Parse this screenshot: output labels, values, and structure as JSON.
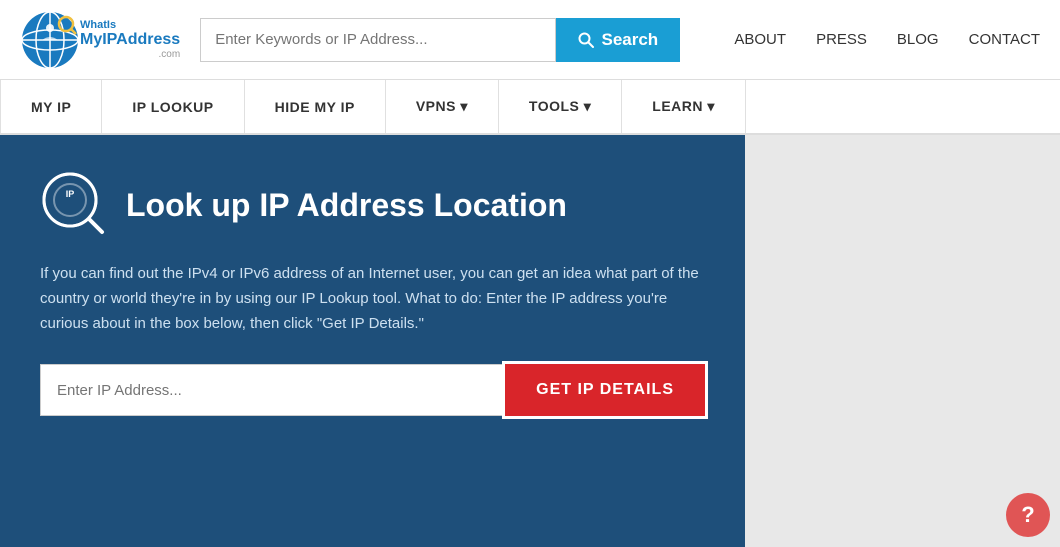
{
  "header": {
    "logo": {
      "what": "WhatIs",
      "myip": "MyIP",
      "address": "Address",
      "com": ".com"
    },
    "search": {
      "placeholder": "Enter Keywords or IP Address...",
      "button_label": "Search"
    },
    "nav_links": [
      {
        "label": "ABOUT"
      },
      {
        "label": "PRESS"
      },
      {
        "label": "BLOG"
      },
      {
        "label": "CONTACT"
      }
    ]
  },
  "navbar": {
    "items": [
      {
        "label": "MY IP"
      },
      {
        "label": "IP LOOKUP"
      },
      {
        "label": "HIDE MY IP"
      },
      {
        "label": "VPNS ▾"
      },
      {
        "label": "TOOLS ▾"
      },
      {
        "label": "LEARN ▾"
      }
    ]
  },
  "hero": {
    "title": "Look up IP Address Location",
    "description": "If you can find out the IPv4 or IPv6 address of an Internet user, you can get an idea what part of the country or world they're in by using our IP Lookup tool. What to do: Enter the IP address you're curious about in the box below, then click \"Get IP Details.\"",
    "input_placeholder": "Enter IP Address...",
    "button_label": "GET IP DETAILS"
  }
}
